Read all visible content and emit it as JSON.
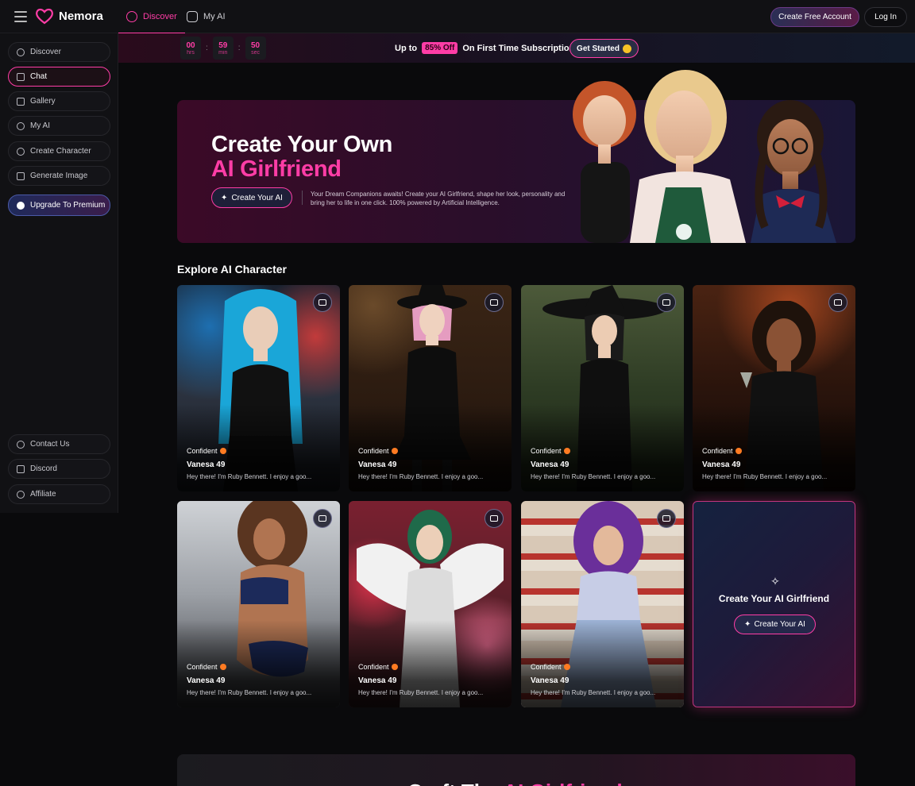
{
  "header": {
    "brand": "Nemora",
    "tabs": [
      {
        "label": "Discover",
        "active": true
      },
      {
        "label": "My AI",
        "active": false
      }
    ],
    "create_account": "Create Free Account",
    "login": "Log In"
  },
  "sidebar": {
    "items": [
      {
        "label": "Discover",
        "icon": "compass-icon"
      },
      {
        "label": "Chat",
        "icon": "chat-icon",
        "active": true
      },
      {
        "label": "Gallery",
        "icon": "grid-icon"
      },
      {
        "label": "My AI",
        "icon": "bot-icon"
      },
      {
        "label": "Create Character",
        "icon": "sparkle-icon"
      },
      {
        "label": "Generate Image",
        "icon": "image-icon"
      }
    ],
    "premium": "Upgrade To Premium",
    "bottom_items": [
      {
        "label": "Contact Us",
        "icon": "chat-icon"
      },
      {
        "label": "Discord",
        "icon": "discord-icon"
      },
      {
        "label": "Affiliate",
        "icon": "gear-icon"
      }
    ]
  },
  "promo": {
    "timer": [
      {
        "value": "00",
        "unit": "hrs"
      },
      {
        "value": "59",
        "unit": "min"
      },
      {
        "value": "50",
        "unit": "sec"
      }
    ],
    "text_before": "Up to",
    "badge": "85% Off",
    "text_after": "On First Time Subscription",
    "cta": "Get Started"
  },
  "hero": {
    "title_line1": "Create Your Own",
    "title_line2": "AI Girlfriend",
    "cta": "Create Your AI",
    "description": "Your Dream Companions awaits! Create your AI Girlfriend, shape her look, personality and bring her to life in one click. 100% powered by Artificial Intelligence."
  },
  "explore": {
    "title": "Explore AI Character",
    "cards": [
      {
        "trait": "Confident",
        "name": "Vanesa 49",
        "desc": "Hey there! I'm Ruby Bennett. I enjoy a goo..."
      },
      {
        "trait": "Confident",
        "name": "Vanesa 49",
        "desc": "Hey there! I'm Ruby Bennett. I enjoy a goo..."
      },
      {
        "trait": "Confident",
        "name": "Vanesa 49",
        "desc": "Hey there! I'm Ruby Bennett. I enjoy a goo..."
      },
      {
        "trait": "Confident",
        "name": "Vanesa 49",
        "desc": "Hey there! I'm Ruby Bennett. I enjoy a goo..."
      },
      {
        "trait": "Confident",
        "name": "Vanesa 49",
        "desc": "Hey there! I'm Ruby Bennett. I enjoy a goo..."
      },
      {
        "trait": "Confident",
        "name": "Vanesa 49",
        "desc": "Hey there! I'm Ruby Bennett. I enjoy a goo..."
      },
      {
        "trait": "Confident",
        "name": "Vanesa 49",
        "desc": "Hey there! I'm Ruby Bennett. I enjoy a goo..."
      }
    ],
    "create_card": {
      "title": "Create Your AI Girlfriend",
      "cta": "Create Your AI"
    }
  },
  "teaser": {
    "text_white": "Craft The ",
    "text_pink": "AI Girlfriend"
  },
  "colors": {
    "accent": "#ff3da6",
    "background": "#0a0a0c",
    "panel": "#111114"
  }
}
